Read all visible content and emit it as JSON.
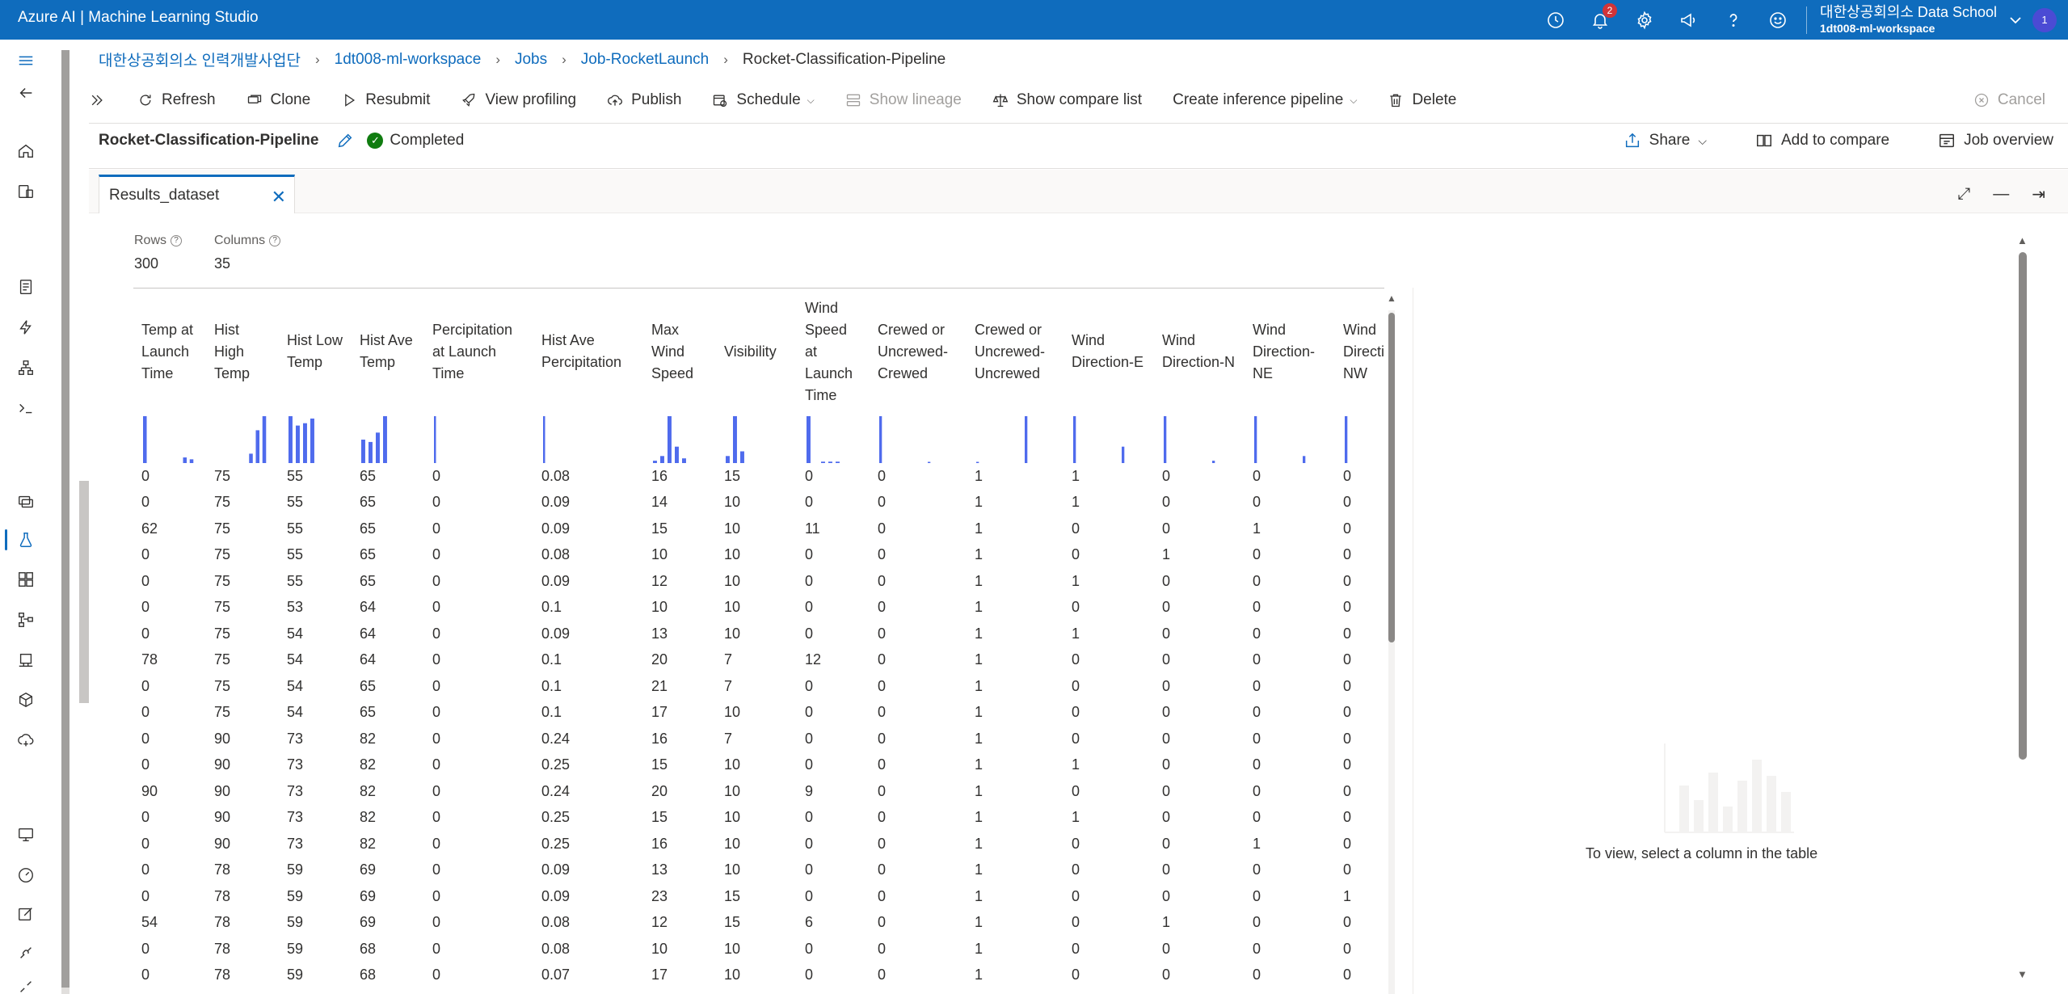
{
  "app": {
    "title": "Azure AI | Machine Learning Studio"
  },
  "topbar": {
    "notification_count": "2",
    "account_org": "대한상공회의소 Data School",
    "account_workspace": "1dt008-ml-workspace",
    "avatar_initial": "1"
  },
  "breadcrumb": {
    "items": [
      "대한상공회의소 인력개발사업단",
      "1dt008-ml-workspace",
      "Jobs",
      "Job-RocketLaunch",
      "Rocket-Classification-Pipeline"
    ]
  },
  "toolbar": {
    "refresh": "Refresh",
    "clone": "Clone",
    "resubmit": "Resubmit",
    "view_profiling": "View profiling",
    "publish": "Publish",
    "schedule": "Schedule",
    "show_lineage": "Show lineage",
    "show_compare_list": "Show compare list",
    "create_inference_pipeline": "Create inference pipeline",
    "delete": "Delete",
    "cancel": "Cancel"
  },
  "pipeline": {
    "name": "Rocket-Classification-Pipeline",
    "status": "Completed",
    "share": "Share",
    "add_to_compare": "Add to compare",
    "job_overview": "Job overview"
  },
  "tab": {
    "label": "Results_dataset"
  },
  "stats": {
    "rows_label": "Rows",
    "rows_value": "300",
    "columns_label": "Columns",
    "columns_value": "35"
  },
  "table": {
    "columns": [
      {
        "label": "Temp at Launch Time",
        "hist": [
          1.0,
          0,
          0,
          0,
          0,
          0,
          0.12,
          0.08
        ]
      },
      {
        "label": "Hist High Temp",
        "hist": [
          0,
          0,
          0,
          0,
          0,
          0.2,
          0.7,
          1.0
        ]
      },
      {
        "label": "Hist Low Temp",
        "hist": [
          1.0,
          0.8,
          0.85,
          0.95
        ]
      },
      {
        "label": "Hist Ave Temp",
        "hist": [
          0.5,
          0.45,
          0.65,
          1.0
        ]
      },
      {
        "label": "Percipitation at Launch Time",
        "hist": [
          1.0
        ]
      },
      {
        "label": "Hist Ave Percipitation",
        "hist": [
          1.0
        ]
      },
      {
        "label": "Max Wind Speed",
        "hist": [
          0.05,
          0.15,
          1.0,
          0.35,
          0.1
        ]
      },
      {
        "label": "Visibility",
        "hist": [
          0.15,
          1.0,
          0.25
        ]
      },
      {
        "label": "Wind Speed at Launch Time",
        "hist": [
          1.0,
          0,
          0.03,
          0.03,
          0.03
        ]
      },
      {
        "label": "Crewed or Uncrewed-Crewed",
        "hist": [
          1.0,
          0,
          0,
          0,
          0,
          0,
          0,
          0,
          0,
          0,
          0.02
        ]
      },
      {
        "label": "Crewed or Uncrewed-Uncrewed",
        "hist": [
          0.02,
          0,
          0,
          0,
          0,
          0,
          0,
          0,
          0,
          0,
          1.0
        ]
      },
      {
        "label": "Wind Direction-E",
        "hist": [
          1.0,
          0,
          0,
          0,
          0,
          0,
          0,
          0,
          0,
          0,
          0.35
        ]
      },
      {
        "label": "Wind Direction-N",
        "hist": [
          1.0,
          0,
          0,
          0,
          0,
          0,
          0,
          0,
          0,
          0,
          0.05
        ]
      },
      {
        "label": "Wind Direction-NE",
        "hist": [
          1.0,
          0,
          0,
          0,
          0,
          0,
          0,
          0,
          0,
          0,
          0.15
        ]
      },
      {
        "label": "Wind Direction-NW",
        "hist": [
          1.0,
          0,
          0,
          0,
          0,
          0,
          0,
          0,
          0,
          0,
          0.05
        ]
      }
    ],
    "rows": [
      [
        "0",
        "75",
        "55",
        "65",
        "0",
        "0.08",
        "16",
        "15",
        "0",
        "0",
        "1",
        "1",
        "0",
        "0",
        "0"
      ],
      [
        "0",
        "75",
        "55",
        "65",
        "0",
        "0.09",
        "14",
        "10",
        "0",
        "0",
        "1",
        "1",
        "0",
        "0",
        "0"
      ],
      [
        "62",
        "75",
        "55",
        "65",
        "0",
        "0.09",
        "15",
        "10",
        "11",
        "0",
        "1",
        "0",
        "0",
        "1",
        "0"
      ],
      [
        "0",
        "75",
        "55",
        "65",
        "0",
        "0.08",
        "10",
        "10",
        "0",
        "0",
        "1",
        "0",
        "1",
        "0",
        "0"
      ],
      [
        "0",
        "75",
        "55",
        "65",
        "0",
        "0.09",
        "12",
        "10",
        "0",
        "0",
        "1",
        "1",
        "0",
        "0",
        "0"
      ],
      [
        "0",
        "75",
        "53",
        "64",
        "0",
        "0.1",
        "10",
        "10",
        "0",
        "0",
        "1",
        "0",
        "0",
        "0",
        "0"
      ],
      [
        "0",
        "75",
        "54",
        "64",
        "0",
        "0.09",
        "13",
        "10",
        "0",
        "0",
        "1",
        "1",
        "0",
        "0",
        "0"
      ],
      [
        "78",
        "75",
        "54",
        "64",
        "0",
        "0.1",
        "20",
        "7",
        "12",
        "0",
        "1",
        "0",
        "0",
        "0",
        "0"
      ],
      [
        "0",
        "75",
        "54",
        "65",
        "0",
        "0.1",
        "21",
        "7",
        "0",
        "0",
        "1",
        "0",
        "0",
        "0",
        "0"
      ],
      [
        "0",
        "75",
        "54",
        "65",
        "0",
        "0.1",
        "17",
        "10",
        "0",
        "0",
        "1",
        "0",
        "0",
        "0",
        "0"
      ],
      [
        "0",
        "90",
        "73",
        "82",
        "0",
        "0.24",
        "16",
        "7",
        "0",
        "0",
        "1",
        "0",
        "0",
        "0",
        "0"
      ],
      [
        "0",
        "90",
        "73",
        "82",
        "0",
        "0.25",
        "15",
        "10",
        "0",
        "0",
        "1",
        "1",
        "0",
        "0",
        "0"
      ],
      [
        "90",
        "90",
        "73",
        "82",
        "0",
        "0.24",
        "20",
        "10",
        "9",
        "0",
        "1",
        "0",
        "0",
        "0",
        "0"
      ],
      [
        "0",
        "90",
        "73",
        "82",
        "0",
        "0.25",
        "15",
        "10",
        "0",
        "0",
        "1",
        "1",
        "0",
        "0",
        "0"
      ],
      [
        "0",
        "90",
        "73",
        "82",
        "0",
        "0.25",
        "16",
        "10",
        "0",
        "0",
        "1",
        "0",
        "0",
        "1",
        "0"
      ],
      [
        "0",
        "78",
        "59",
        "69",
        "0",
        "0.09",
        "13",
        "10",
        "0",
        "0",
        "1",
        "0",
        "0",
        "0",
        "0"
      ],
      [
        "0",
        "78",
        "59",
        "69",
        "0",
        "0.09",
        "23",
        "15",
        "0",
        "0",
        "1",
        "0",
        "0",
        "0",
        "1"
      ],
      [
        "54",
        "78",
        "59",
        "69",
        "0",
        "0.08",
        "12",
        "15",
        "6",
        "0",
        "1",
        "0",
        "1",
        "0",
        "0"
      ],
      [
        "0",
        "78",
        "59",
        "68",
        "0",
        "0.08",
        "10",
        "10",
        "0",
        "0",
        "1",
        "0",
        "0",
        "0",
        "0"
      ],
      [
        "0",
        "78",
        "59",
        "68",
        "0",
        "0.07",
        "17",
        "10",
        "0",
        "0",
        "1",
        "0",
        "0",
        "0",
        "0"
      ]
    ]
  },
  "right_panel": {
    "empty_text": "To view, select a column in the table"
  },
  "colors": {
    "accent": "#0f6cbd",
    "hist_bar": "#4f6bed",
    "success": "#107c10"
  }
}
